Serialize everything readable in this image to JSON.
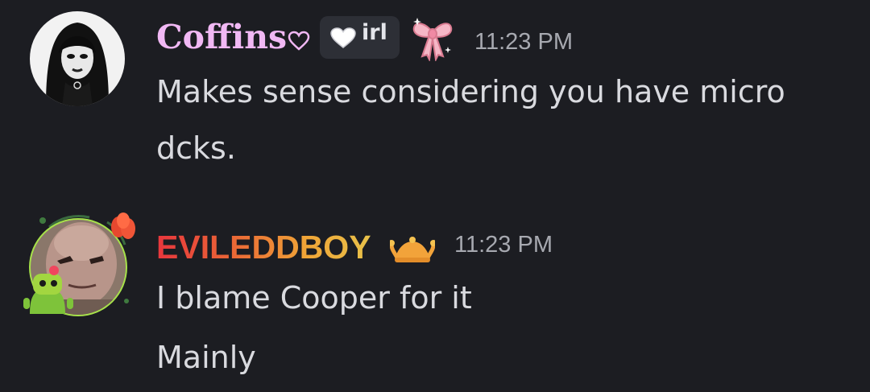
{
  "messages": [
    {
      "username": "Coffins",
      "username_color": "#f1b8f4",
      "tag_label": "irl",
      "timestamp": "11:23 PM",
      "lines": [
        "Makes sense considering you have micro",
        "dcks."
      ],
      "icons": [
        "heart-outline-icon",
        "heart-icon",
        "pink-bow-icon"
      ]
    },
    {
      "username": "EVILEDDBOY",
      "username_gradient": [
        "#e8363d",
        "#f0a537",
        "#e8c24a"
      ],
      "timestamp": "11:23 PM",
      "lines": [
        "I blame Cooper for it",
        "Mainly"
      ],
      "icons": [
        "jester-hat-icon"
      ]
    }
  ]
}
